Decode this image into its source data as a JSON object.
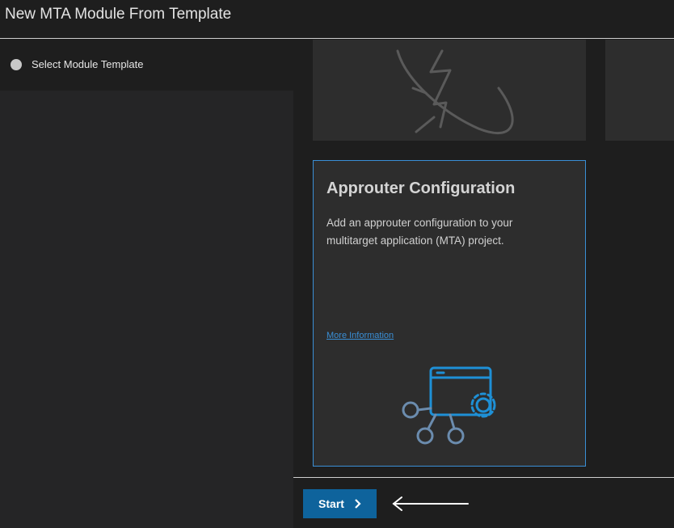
{
  "header": {
    "title": "New MTA Module From Template"
  },
  "steps": [
    {
      "label": "Select Module Template"
    }
  ],
  "card": {
    "title": "Approuter Configuration",
    "description": "Add an approuter configuration to your multitarget application (MTA) project.",
    "link": "More Information"
  },
  "footer": {
    "start_label": "Start"
  },
  "icons": {
    "top_card": "lightning-orbit-icon",
    "card": "app-gear-network-icon",
    "start": "chevron-right-icon",
    "annotation": "arrow-left-icon"
  },
  "colors": {
    "accent": "#3a8fd6",
    "button": "#0e639c",
    "icon": "#1e90d6"
  }
}
